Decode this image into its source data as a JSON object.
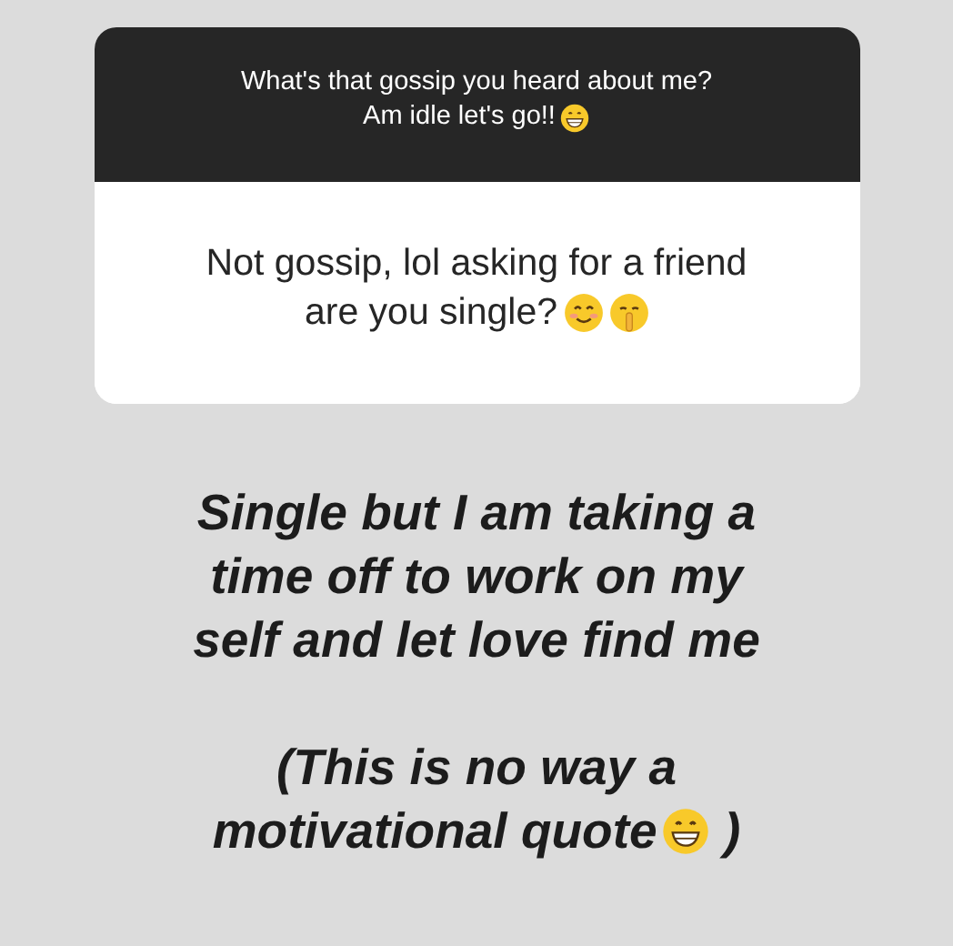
{
  "question_sticker": {
    "question": [
      [
        {
          "kind": "text",
          "text": "What's that gossip you heard about me?"
        }
      ],
      [
        {
          "kind": "text",
          "text": "Am idle let's go!!"
        },
        {
          "kind": "grin"
        }
      ]
    ],
    "answer": [
      [
        {
          "kind": "text",
          "text": "Not gossip, lol asking for a friend"
        }
      ],
      [
        {
          "kind": "text",
          "text": "are you single?"
        },
        {
          "kind": "blush"
        },
        {
          "kind": "shush"
        }
      ]
    ]
  },
  "reply": [
    [
      [
        {
          "kind": "text",
          "text": "Single but I am taking a"
        }
      ],
      [
        {
          "kind": "text",
          "text": "time off to work on my"
        }
      ],
      [
        {
          "kind": "text",
          "text": "self and let love find me"
        }
      ]
    ],
    [
      [
        {
          "kind": "text",
          "text": "(This is no way a"
        }
      ],
      [
        {
          "kind": "text",
          "text": "motivational quote"
        },
        {
          "kind": "grin"
        },
        {
          "kind": "text",
          "text": " )"
        }
      ]
    ]
  ]
}
